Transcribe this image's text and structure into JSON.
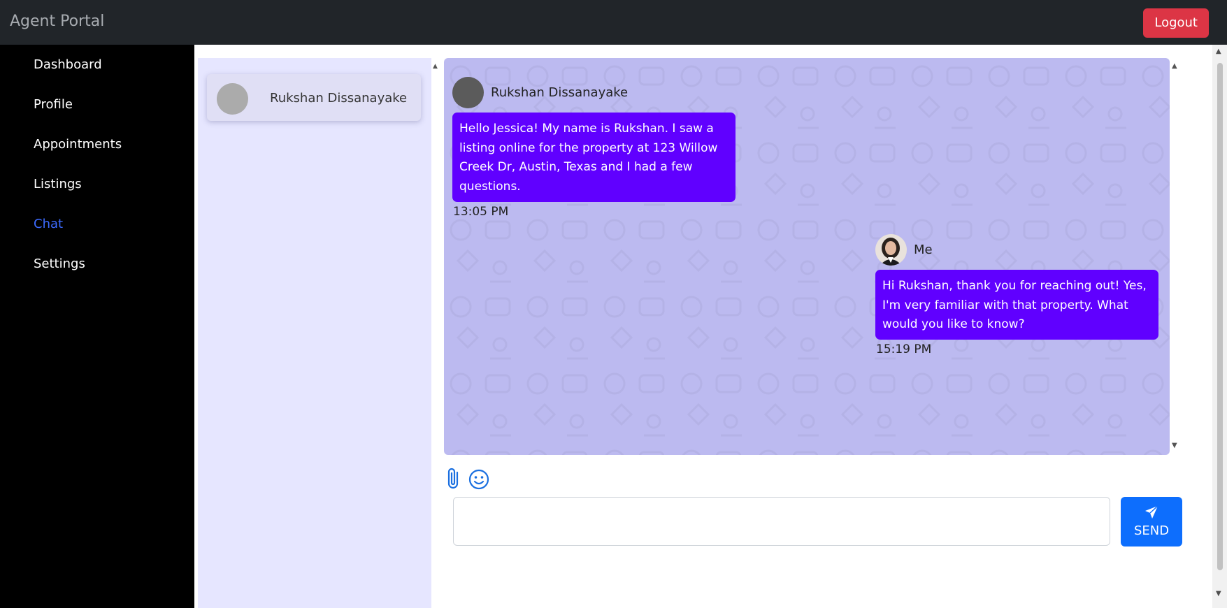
{
  "app": {
    "title": "Agent Portal",
    "logout_label": "Logout"
  },
  "sidebar": {
    "items": [
      {
        "label": "Dashboard",
        "active": false
      },
      {
        "label": "Profile",
        "active": false
      },
      {
        "label": "Appointments",
        "active": false
      },
      {
        "label": "Listings",
        "active": false
      },
      {
        "label": "Chat",
        "active": true
      },
      {
        "label": "Settings",
        "active": false
      }
    ]
  },
  "contacts": [
    {
      "name": "Rukshan Dissanayake"
    }
  ],
  "messages": [
    {
      "sender": "Rukshan Dissanayake",
      "text": "Hello Jessica! My name is Rukshan. I saw a listing online for the property at 123 Willow Creek Dr, Austin, Texas and I had a few questions.",
      "time": "13:05 PM",
      "direction": "incoming"
    },
    {
      "sender": "Me",
      "text": "Hi Rukshan, thank you for reaching out! Yes, I'm very familiar with that property. What would you like to know?",
      "time": "15:19 PM",
      "direction": "outgoing"
    }
  ],
  "composer": {
    "value": "",
    "send_label": "SEND",
    "attach_icon": "paperclip-icon",
    "emoji_icon": "smiley-icon",
    "send_icon": "paper-plane-icon"
  },
  "colors": {
    "topbar": "#212529",
    "sidebar": "#000000",
    "active_nav": "#3d6bff",
    "logout": "#dc3545",
    "chat_background": "#bcbaf0",
    "bubble": "#6000ff",
    "contact_panel": "#e6e6ff",
    "send_button": "#0d6efd"
  }
}
